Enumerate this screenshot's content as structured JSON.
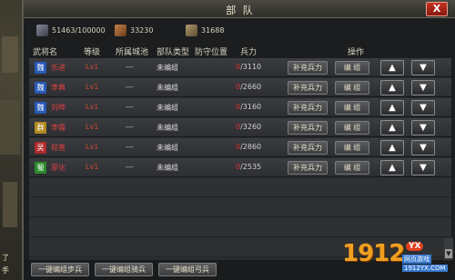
{
  "window": {
    "title": "部 队",
    "close_label": "X"
  },
  "resources": [
    {
      "icon": "troops-icon",
      "value": "51463/100000"
    },
    {
      "icon": "food-icon",
      "value": "33230"
    },
    {
      "icon": "weapon-icon",
      "value": "31688"
    }
  ],
  "columns": {
    "general": "武将名",
    "level": "等级",
    "city": "所属城池",
    "unit_type": "部队类型",
    "defense": "防守位置",
    "troops": "兵力",
    "actions": "操作"
  },
  "rows": [
    {
      "faction": "魏",
      "faction_color": "#2a5ab8",
      "name": "乐进",
      "level": "Lv1",
      "city": "---",
      "unit_type": "未编组",
      "troops_current": "0",
      "troops_max": "/3110",
      "supply": "补充兵力",
      "edit": "编 组",
      "up": "▲",
      "down": "▼"
    },
    {
      "faction": "魏",
      "faction_color": "#2a5ab8",
      "name": "李典",
      "level": "Lv1",
      "city": "---",
      "unit_type": "未编组",
      "troops_current": "0",
      "troops_max": "/2660",
      "supply": "补充兵力",
      "edit": "编 组",
      "up": "▲",
      "down": "▼"
    },
    {
      "faction": "魏",
      "faction_color": "#2a5ab8",
      "name": "刘晔",
      "level": "Lv1",
      "city": "---",
      "unit_type": "未编组",
      "troops_current": "0",
      "troops_max": "/3160",
      "supply": "补充兵力",
      "edit": "编 组",
      "up": "▲",
      "down": "▼"
    },
    {
      "faction": "群",
      "faction_color": "#b08a20",
      "name": "李儒",
      "level": "Lv1",
      "city": "---",
      "unit_type": "未编组",
      "troops_current": "0",
      "troops_max": "/3260",
      "supply": "补充兵力",
      "edit": "编 组",
      "up": "▲",
      "down": "▼"
    },
    {
      "faction": "吴",
      "faction_color": "#b02a2a",
      "name": "程普",
      "level": "Lv1",
      "city": "---",
      "unit_type": "未编组",
      "troops_current": "0",
      "troops_max": "/2860",
      "supply": "补充兵力",
      "edit": "编 组",
      "up": "▲",
      "down": "▼"
    },
    {
      "faction": "蜀",
      "faction_color": "#2a8a2a",
      "name": "廖化",
      "level": "Lv1",
      "city": "---",
      "unit_type": "未编组",
      "troops_current": "0",
      "troops_max": "/2535",
      "supply": "补充兵力",
      "edit": "编 组",
      "up": "▲",
      "down": "▼"
    }
  ],
  "bottom_buttons": {
    "infantry": "一键编组步兵",
    "cavalry": "一键编组骑兵",
    "archer": "一键编组弓兵"
  },
  "scenery_text": {
    "top": "了",
    "bottom": "手"
  },
  "watermark": {
    "number": "1912",
    "badge": "YX",
    "tagline": "网页游戏",
    "url": "1912YX.COM"
  }
}
